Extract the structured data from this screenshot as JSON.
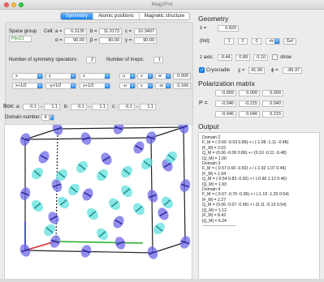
{
  "window": {
    "title": "Mag2Pol"
  },
  "tabs": [
    {
      "label": "Symmetry",
      "active": true
    },
    {
      "label": "Atomic positions",
      "active": false
    },
    {
      "label": "Magnetic structure",
      "active": false
    }
  ],
  "cell": {
    "space_group_label": "Space group",
    "space_group_value": "Pbn21",
    "cell_label": "Cell:",
    "a_label": "a =",
    "a": "6.3135",
    "b_label": "b =",
    "b": "11.0173",
    "c_label": "c =",
    "c": "10.3497",
    "alpha_label": "α =",
    "alpha": "90.00",
    "beta_label": "β =",
    "beta": "90.00",
    "gamma_label": "γ =",
    "gamma": "90.00"
  },
  "symmetry": {
    "nops_label": "Number of symmetry operators:",
    "nops": "2",
    "nirreps_label": "Number of irreps:",
    "nirreps": "1",
    "rows": [
      {
        "x": "x",
        "y": "y",
        "z": "z",
        "u": "u",
        "v": "v",
        "w": "w",
        "phase": "0.000"
      },
      {
        "x": "x+1/2",
        "y": "-y+1/2",
        "z": "z+1/2",
        "u": "-u",
        "v": "v",
        "w": "-w",
        "phase": "0.166"
      }
    ]
  },
  "box": {
    "label": "Box:",
    "a_label": "a:",
    "a_min": "-0.1",
    "a_max": "1.1",
    "b_label": "b:",
    "b_min": "-0.1",
    "b_max": "1.1",
    "c_label": "c:",
    "c_min": "-0.1",
    "c_max": "1.1",
    "domain_label": "Domain number:",
    "domain": "4"
  },
  "geometry": {
    "title": "Geometry",
    "lambda_label": "λ =",
    "lambda": "0.820",
    "hkl_label": "(hkl):",
    "h": "1",
    "k": "2",
    "l": "0",
    "hkl_mode": "+k",
    "go_label": "Go!",
    "zaxis_label": "z axis:",
    "zx": "-0.44",
    "zy": "0.89",
    "zz": "0.10",
    "show_label": "show",
    "show_checked": false,
    "cryocradle_label": "Cryocradle",
    "cryocradle_checked": true,
    "chi_label": "χ =",
    "chi": "41.90",
    "phi_label": "ϕ =",
    "phi": "-89.37"
  },
  "polarization": {
    "title": "Polarization matrix",
    "p_label": "P =",
    "rows": [
      [
        "-0.959",
        "0.000",
        "0.000"
      ],
      [
        "-0.046",
        "-0.215",
        "0.040"
      ],
      [
        "-0.046",
        "0.040",
        "0.215"
      ]
    ]
  },
  "output": {
    "title": "Output",
    "lines": [
      "Domain 2",
      "F_M = (-0.60 -0.63 0.86) + i (-1.08 -1.11 -0.48)",
      "|F_M| = 2.02",
      "Q_M = (0.06 -0.06 0.86) + i (0.10 -0.11 -0.48)",
      "|Q_M| = 1.00",
      "",
      "Domain 3",
      "F_M = (-0.57 0.60 -0.82) + i (-1.02 1.07 0.46)",
      "|F_M| = 1.94",
      "Q_M = (-0.54 0.83 -0.82) + i (-0.96 1.12 0.46)",
      "|Q_M| = 1.93",
      "",
      "Domain 4",
      "F_M = (-0.67 -0.70 -0.96) + i (-1.19 -1.25 0.54)",
      "|F_M| = 2.27",
      "Q_M = (0.06 -0.07 -0.96) + i (0.11 -0.13 0.54)",
      "|Q_M| = 1.12",
      "",
      "|F_M| = 8.42",
      "|Q_M| = 6.24",
      "",
      "------------------------"
    ]
  },
  "colors": {
    "atom_blue": "#6e68e8",
    "atom_cyan": "#5fe0de",
    "accent": "#1a82f0",
    "axis_a": "#e03030",
    "axis_b": "#20b020",
    "axis_c": "#2030d0"
  }
}
